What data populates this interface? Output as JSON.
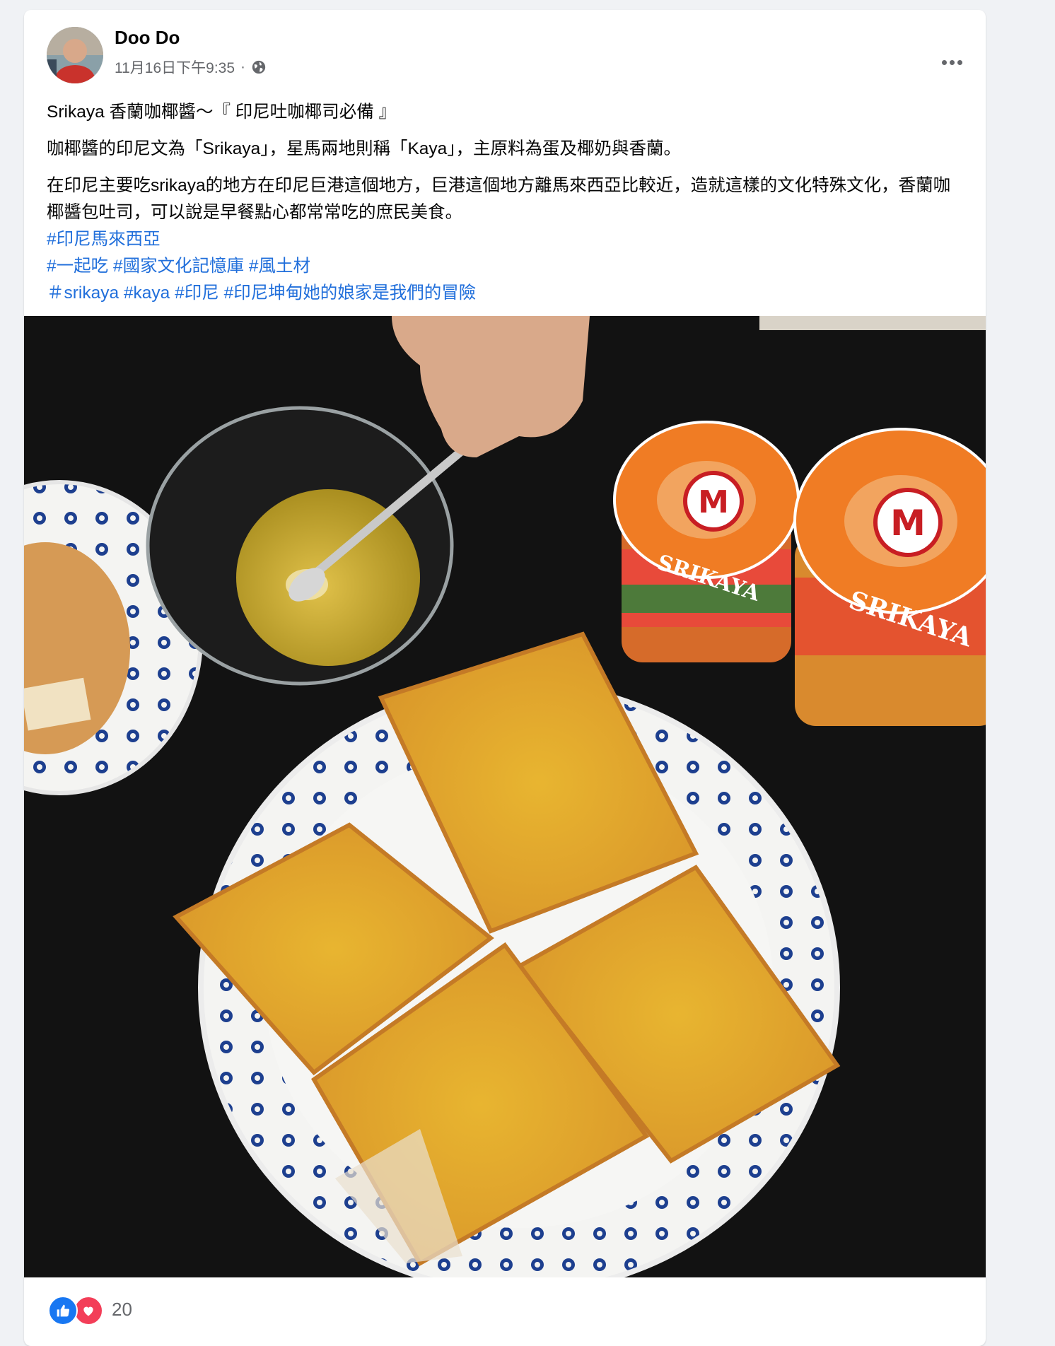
{
  "post": {
    "author": "Doo Do",
    "timestamp": "11月16日下午9:35",
    "separator": "·",
    "privacy_icon": "globe-icon",
    "more_icon": "more-options-icon",
    "title": "Srikaya 香蘭咖椰醬～『 印尼吐咖椰司必備 』",
    "paragraph_1": "咖椰醬的印尼文為「Srikaya」，星馬兩地則稱「Kaya」，主原料為蛋及椰奶與香蘭。",
    "paragraph_2": "在印尼主要吃srikaya的地方在印尼巨港這個地方，巨港這個地方離馬來西亞比較近，造就這樣的文化特殊文化，香蘭咖椰醬包吐司，可以說是早餐點心都常常吃的庶民美食。",
    "hashtags_line_1": [
      "#印尼馬來西亞"
    ],
    "hashtags_line_2": [
      "#一起吃",
      "#國家文化記憶庫",
      "#風土材"
    ],
    "hashtags_line_3": [
      "＃srikaya",
      "#kaya",
      "#印尼",
      "#印尼坤甸她的娘家是我們的冒險"
    ]
  },
  "photo": {
    "jar_brand": "M",
    "jar_label": "SRIKAYA"
  },
  "reactions": {
    "icons": [
      "like-icon",
      "love-icon"
    ],
    "count": "20"
  },
  "colors": {
    "link": "#216fdb",
    "secondary_text": "#65676b",
    "like_blue": "#1877f2",
    "love_red": "#f33e58"
  }
}
